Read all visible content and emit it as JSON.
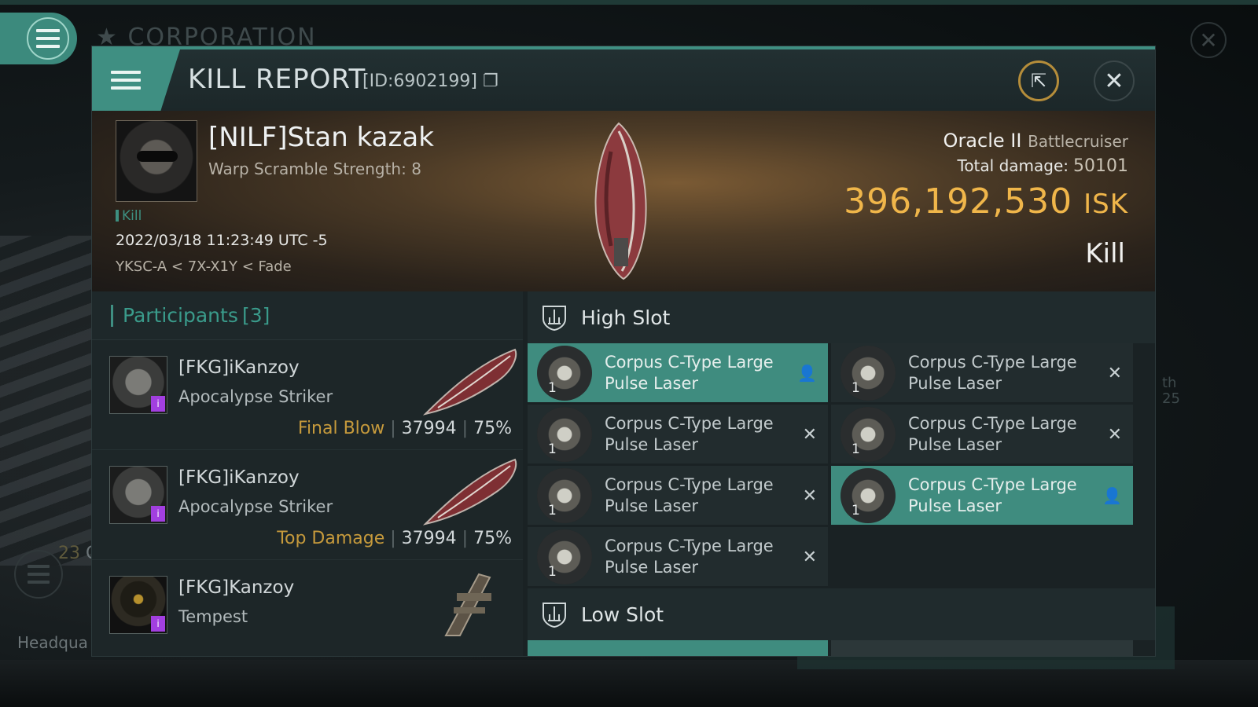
{
  "background": {
    "corp_label": "CORPORATION",
    "hq_label": "Headqua",
    "side_number": "23",
    "side_letter": "C",
    "right_text_1": "th",
    "right_text_2": "25"
  },
  "header": {
    "title": "KILL REPORT",
    "report_id": "[ID:6902199]"
  },
  "victim": {
    "name": "[NILF]Stan kazak",
    "warp_scramble": "Warp Scramble Strength: 8",
    "tag": "Kill",
    "datetime": "2022/03/18 11:23:49 UTC -5",
    "location": "YKSC-A < 7X-X1Y < Fade",
    "ship_name": "Oracle II",
    "ship_class": "Battlecruiser",
    "total_damage_label": "Total damage:",
    "total_damage": "50101",
    "isk_value": "396,192,530",
    "isk_unit": "ISK",
    "result": "Kill"
  },
  "participants": {
    "header_label": "Participants",
    "count": "[3]",
    "rows": [
      {
        "name": "[FKG]iKanzoy",
        "ship": "Apocalypse Striker",
        "role": "Final Blow",
        "damage": "37994",
        "percent": "75%"
      },
      {
        "name": "[FKG]iKanzoy",
        "ship": "Apocalypse Striker",
        "role": "Top Damage",
        "damage": "37994",
        "percent": "75%"
      },
      {
        "name": "[FKG]Kanzoy",
        "ship": "Tempest",
        "role": "",
        "damage": "",
        "percent": ""
      }
    ]
  },
  "fitting": {
    "high_slot_label": "High Slot",
    "low_slot_label": "Low Slot",
    "high_items": [
      {
        "line1": "Corpus C-Type Large",
        "line2": "Pulse Laser",
        "qty": "1",
        "status": "person",
        "active": true
      },
      {
        "line1": "Corpus C-Type Large",
        "line2": "Pulse Laser",
        "qty": "1",
        "status": "destroyed",
        "active": false
      },
      {
        "line1": "Corpus C-Type Large",
        "line2": "Pulse Laser",
        "qty": "1",
        "status": "destroyed",
        "active": false
      },
      {
        "line1": "Corpus C-Type Large",
        "line2": "Pulse Laser",
        "qty": "1",
        "status": "destroyed",
        "active": false
      },
      {
        "line1": "Corpus C-Type Large",
        "line2": "Pulse Laser",
        "qty": "1",
        "status": "destroyed",
        "active": false
      },
      {
        "line1": "Corpus C-Type Large",
        "line2": "Pulse Laser",
        "qty": "1",
        "status": "person",
        "active": true
      },
      {
        "line1": "Corpus C-Type Large",
        "line2": "Pulse Laser",
        "qty": "1",
        "status": "destroyed",
        "active": false
      }
    ],
    "status_icons": {
      "destroyed": "✕",
      "person": "👤"
    }
  },
  "colors": {
    "accent": "#3f8f82",
    "isk_gold": "#f0b64a",
    "role_gold": "#c69a3c",
    "fitted_bg": "#3f8c7f"
  }
}
